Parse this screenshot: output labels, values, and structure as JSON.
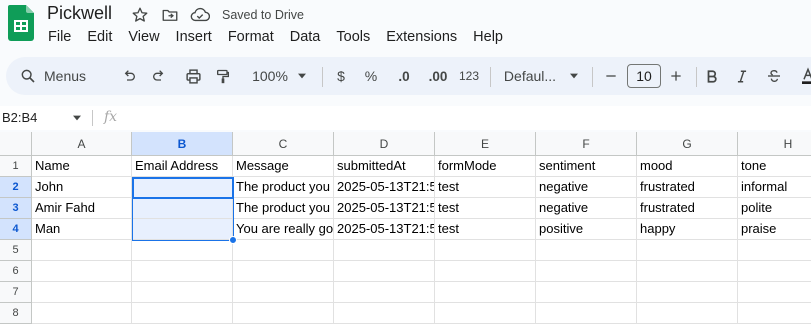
{
  "app": {
    "title": "Pickwell",
    "save_status": "Saved to Drive",
    "brand_color": "#0f9d58"
  },
  "menu": [
    "File",
    "Edit",
    "View",
    "Insert",
    "Format",
    "Data",
    "Tools",
    "Extensions",
    "Help"
  ],
  "toolbar": {
    "menus_search": "Menus",
    "zoom": "100%",
    "currency": "$",
    "percent": "%",
    "decrease_decimal": ".0",
    "increase_decimal": ".00",
    "number_format": "123",
    "font": "Defaul...",
    "font_size": "10",
    "icons": [
      "search-icon",
      "undo-icon",
      "redo-icon",
      "print-icon",
      "paint-format-icon",
      "minus-icon",
      "plus-icon",
      "bold-icon",
      "italic-icon",
      "strikethrough-icon",
      "text-color-icon"
    ]
  },
  "formula_bar": {
    "name_box": "B2:B4",
    "fx": "fx",
    "value": ""
  },
  "sheet": {
    "columns": [
      "A",
      "B",
      "C",
      "D",
      "E",
      "F",
      "G",
      "H"
    ],
    "row_numbers": [
      "1",
      "2",
      "3",
      "4",
      "5",
      "6",
      "7",
      "8"
    ],
    "rows": [
      [
        "Name",
        "Email Address",
        "Message",
        "submittedAt",
        "formMode",
        "sentiment",
        "mood",
        "tone"
      ],
      [
        "John",
        "",
        "The product you",
        "2025-05-13T21:5",
        "test",
        "negative",
        "frustrated",
        "informal"
      ],
      [
        "Amir Fahd",
        "",
        "The product you",
        "2025-05-13T21:5",
        "test",
        "negative",
        "frustrated",
        "polite"
      ],
      [
        "Man",
        "",
        "You are really go",
        "2025-05-13T21:5",
        "test",
        "positive",
        "happy",
        "praise"
      ],
      [
        "",
        "",
        "",
        "",
        "",
        "",
        "",
        ""
      ],
      [
        "",
        "",
        "",
        "",
        "",
        "",
        "",
        ""
      ],
      [
        "",
        "",
        "",
        "",
        "",
        "",
        "",
        ""
      ],
      [
        "",
        "",
        "",
        "",
        "",
        "",
        "",
        ""
      ]
    ],
    "selected_column": "B",
    "selected_rows": [
      "2",
      "3",
      "4"
    ],
    "selection_color": "#1a73e8"
  }
}
